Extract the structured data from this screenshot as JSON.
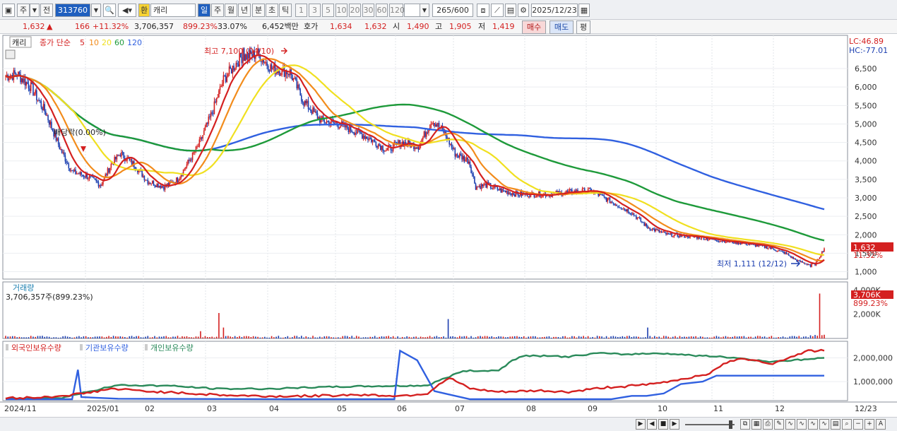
{
  "toolbar": {
    "market": "주",
    "prev": "전",
    "code": "313760",
    "tag": "환",
    "name": "캐리",
    "periods": [
      "일",
      "주",
      "월",
      "년",
      "분",
      "초",
      "틱"
    ],
    "active_period": "일",
    "intervals": [
      "1",
      "3",
      "5",
      "10",
      "20",
      "30",
      "60",
      "120"
    ],
    "count": "265",
    "count_max": "/600",
    "date": "2025/12/23"
  },
  "info": {
    "price": "1,632",
    "arrow": "▲",
    "change": "166",
    "change_pct": "+11.32%",
    "volume": "3,706,357",
    "volume_ratio": "899.23%",
    "turnover": "33.07%",
    "amount": "6,452백만",
    "quote_label": "호가",
    "ask": "1,634",
    "bid": "1,632",
    "open_label": "시",
    "open": "1,490",
    "high_label": "고",
    "high": "1,905",
    "low_label": "저",
    "low": "1,419",
    "buy_button": "매수",
    "sell_button": "매도",
    "eval_button": "평"
  },
  "price_panel": {
    "legend_name": "캐리",
    "legend_ma_title": "종가 단순",
    "ma_periods": [
      "5",
      "10",
      "20",
      "60",
      "120"
    ],
    "ma_colors": [
      "#d42020",
      "#f28c1c",
      "#f0e020",
      "#1e9a3a",
      "#3060e0"
    ],
    "lc": "LC:46.89",
    "hc": "HC:-77.01",
    "y_ticks": [
      "6,500",
      "6,000",
      "5,500",
      "5,000",
      "4,500",
      "4,000",
      "3,500",
      "3,000",
      "2,500",
      "2,000",
      "1,500",
      "1,000"
    ],
    "current_price": "1,632",
    "current_pct": "11.32%",
    "high_label": "최고 7,100 (04/10)",
    "low_label": "최저 1,111 (12/12)",
    "dividend_label": "배당락(0.00%)"
  },
  "volume_panel": {
    "title": "거래량",
    "subtitle": "3,706,357주(899.23%)",
    "y_ticks": [
      "4,000K",
      "2,000K"
    ],
    "current_value": "3,706K",
    "current_pct": "899.23%"
  },
  "holdings_panel": {
    "series": [
      {
        "name": "외국인보유수량",
        "color": "#d42020"
      },
      {
        "name": "기관보유수량",
        "color": "#3060e0"
      },
      {
        "name": "개인보유수량",
        "color": "#2a8a5a"
      }
    ],
    "y_ticks": [
      "2,000,000",
      "1,000,000"
    ]
  },
  "x_axis": {
    "labels": [
      "2024/11",
      "2025/01",
      "02",
      "03",
      "04",
      "05",
      "06",
      "07",
      "08",
      "09",
      "10",
      "11",
      "12",
      "12/23"
    ]
  },
  "chart_data": {
    "type": "line",
    "title": "",
    "price_series": [
      {
        "date": "2024/11",
        "close": 6300
      },
      {
        "date": "2024/12",
        "close": 4200
      },
      {
        "date": "2025/01",
        "close": 3500
      },
      {
        "date": "2025/02",
        "close": 4100
      },
      {
        "date": "2025/03",
        "close": 3300
      },
      {
        "date": "2025/04",
        "close": 6900
      },
      {
        "date": "2025/05",
        "close": 5200
      },
      {
        "date": "2025/06",
        "close": 4400
      },
      {
        "date": "2025/07",
        "close": 4700
      },
      {
        "date": "2025/08",
        "close": 3100
      },
      {
        "date": "2025/09",
        "close": 3150
      },
      {
        "date": "2025/10",
        "close": 2000
      },
      {
        "date": "2025/11",
        "close": 1600
      },
      {
        "date": "2025/12",
        "close": 1632
      }
    ],
    "ylim": [
      800,
      7400
    ],
    "volume_ylim": [
      0,
      4200000
    ],
    "holdings_ylim": [
      200000,
      2700000
    ]
  }
}
